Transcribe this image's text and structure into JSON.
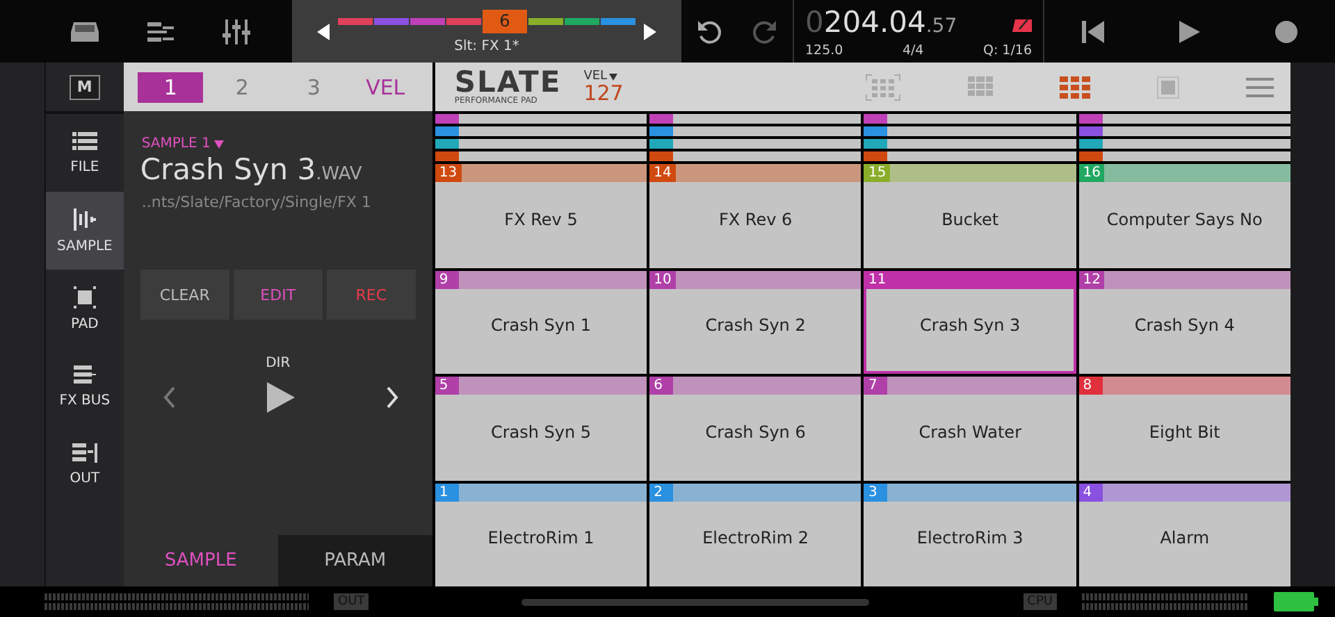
{
  "top_bar": {
    "bank": {
      "slots": [
        {
          "color": "#e0405a",
          "selected": false
        },
        {
          "color": "#8a50e0",
          "selected": false
        },
        {
          "color": "#c040b8",
          "selected": false
        },
        {
          "color": "#e0405a",
          "selected": false
        },
        {
          "color": "#e05a14",
          "selected": true,
          "label": "6"
        },
        {
          "color": "#8aae2a",
          "selected": false
        },
        {
          "color": "#20a860",
          "selected": false
        },
        {
          "color": "#2a90e0",
          "selected": false
        }
      ],
      "caption": "Slt: FX 1*"
    },
    "counter": {
      "lead": "0",
      "main": "204.04",
      "fraction": ".57"
    },
    "tempo": "125.0",
    "signature": "4/4",
    "quantize": "Q: 1/16"
  },
  "sidebar": {
    "m_button": "M",
    "items": [
      {
        "label": "FILE",
        "kind": "file",
        "selected": false
      },
      {
        "label": "SAMPLE",
        "kind": "sample",
        "selected": true
      },
      {
        "label": "PAD",
        "kind": "pad",
        "selected": false
      },
      {
        "label": "FX BUS",
        "kind": "fxbus",
        "selected": false
      },
      {
        "label": "OUT",
        "kind": "out",
        "selected": false
      }
    ]
  },
  "sample_panel": {
    "tabs": [
      {
        "label": "1",
        "selected": true
      },
      {
        "label": "2",
        "selected": false
      },
      {
        "label": "3",
        "selected": false
      },
      {
        "label": "VEL",
        "selected": false
      }
    ],
    "sample_slot": "SAMPLE 1",
    "file_name": "Crash Syn 3",
    "extension": ".WAV",
    "path": "..nts/Slate/Factory/Single/FX 1",
    "buttons": [
      {
        "label": "CLEAR",
        "kind": "clear"
      },
      {
        "label": "EDIT",
        "kind": "edit"
      },
      {
        "label": "REC",
        "kind": "rec"
      }
    ],
    "direction_label": "DIR",
    "bottom_tabs": [
      {
        "label": "SAMPLE",
        "selected": true
      },
      {
        "label": "PARAM",
        "selected": false
      }
    ]
  },
  "pad_view": {
    "logo": "SLATE",
    "logo_subtitle": "PERFORMANCE PAD",
    "velocity_label": "VEL",
    "velocity": "127",
    "layer_strips": [
      [
        {
          "color": "#c040b8"
        },
        {
          "color": "#2a90e0"
        },
        {
          "color": "#20a8b8"
        },
        {
          "color": "#d04a10"
        }
      ],
      [
        {
          "color": "#c040b8"
        },
        {
          "color": "#2a90e0"
        },
        {
          "color": "#20a8b8"
        },
        {
          "color": "#d04a10"
        }
      ],
      [
        {
          "color": "#c040b8"
        },
        {
          "color": "#2a90e0"
        },
        {
          "color": "#20a8b8"
        },
        {
          "color": "#d04a10"
        }
      ],
      [
        {
          "color": "#c040b8"
        },
        {
          "color": "#8a50e0"
        },
        {
          "color": "#20a8b8"
        },
        {
          "color": "#d04a10"
        }
      ]
    ],
    "pads": [
      {
        "number": "13",
        "name": "FX Rev 5",
        "color": "#d04a10",
        "selected": false
      },
      {
        "number": "14",
        "name": "FX Rev 6",
        "color": "#d04a10",
        "selected": false
      },
      {
        "number": "15",
        "name": "Bucket",
        "color": "#8aae2a",
        "selected": false
      },
      {
        "number": "16",
        "name": "Computer Says No",
        "color": "#20a860",
        "selected": false
      },
      {
        "number": "9",
        "name": "Crash Syn 1",
        "color": "#b040a8",
        "selected": false
      },
      {
        "number": "10",
        "name": "Crash Syn 2",
        "color": "#b040a8",
        "selected": false
      },
      {
        "number": "11",
        "name": "Crash Syn 3",
        "color": "#c030a8",
        "selected": true
      },
      {
        "number": "12",
        "name": "Crash Syn 4",
        "color": "#b040a8",
        "selected": false
      },
      {
        "number": "5",
        "name": "Crash Syn 5",
        "color": "#b040a8",
        "selected": false
      },
      {
        "number": "6",
        "name": "Crash Syn 6",
        "color": "#b040a8",
        "selected": false
      },
      {
        "number": "7",
        "name": "Crash Water",
        "color": "#b040a8",
        "selected": false
      },
      {
        "number": "8",
        "name": "Eight Bit",
        "color": "#e0303c",
        "selected": false
      },
      {
        "number": "1",
        "name": "ElectroRim 1",
        "color": "#2a90e0",
        "selected": false
      },
      {
        "number": "2",
        "name": "ElectroRim 2",
        "color": "#2a90e0",
        "selected": false
      },
      {
        "number": "3",
        "name": "ElectroRim 3",
        "color": "#2a90e0",
        "selected": false
      },
      {
        "number": "4",
        "name": "Alarm",
        "color": "#8a50e0",
        "selected": false
      }
    ]
  },
  "bottom_bar": {
    "out_label": "OUT",
    "cpu_label": "CPU"
  }
}
